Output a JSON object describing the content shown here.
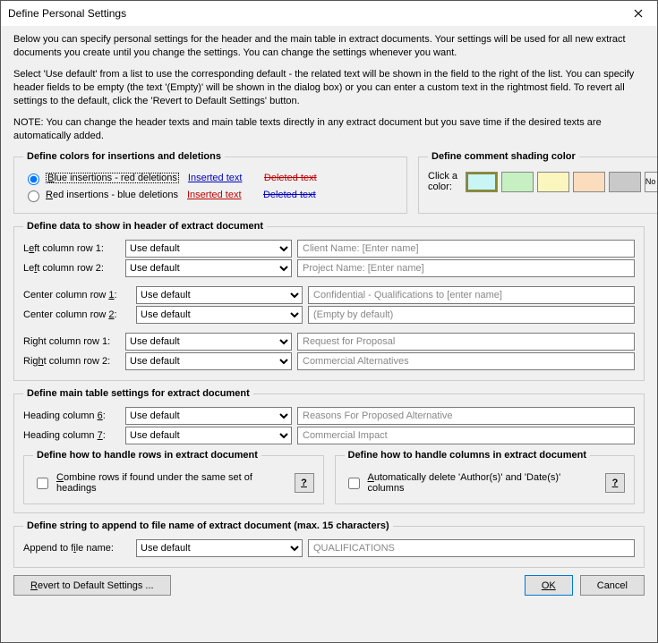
{
  "window": {
    "title": "Define Personal Settings"
  },
  "intro": {
    "p1": "Below you can specify personal settings for the header and the main table in extract documents. Your settings will be used for all new extract documents you create until you change the settings. You can change the settings whenever you want.",
    "p2": "Select 'Use default' from a list to use the corresponding default - the related text will be shown in the field to the right of the list. You can specify header fields to be empty (the text '(Empty)' will be shown in the dialog box) or you can enter a custom text in the rightmost field. To revert all settings to the default, click the 'Revert to Default Settings' button.",
    "p3": "NOTE: You can change the header texts and main table texts directly in any extract document but you save time if the desired texts are automatically added."
  },
  "colors": {
    "legend": "Define colors for insertions and deletions",
    "opt1": {
      "label": "Blue insertions - red deletions",
      "ins": "Inserted text",
      "del": "Deleted text"
    },
    "opt2": {
      "label": "Red insertions - blue deletions",
      "ins": "Inserted text",
      "del": "Deleted text"
    }
  },
  "shade": {
    "legend": "Define comment shading color",
    "label": "Click a color:",
    "colors": [
      "#C9F5F7",
      "#C7F0C2",
      "#FBF6BE",
      "#FBDDBE",
      "#C9C9C9"
    ],
    "nocolor": "No color"
  },
  "header": {
    "legend": "Define data to show in header of extract document",
    "default_option": "Use default",
    "left1": {
      "label": "Left column row 1:",
      "text": "Client Name: [Enter name]"
    },
    "left2": {
      "label": "Left column row 2:",
      "text": "Project Name: [Enter name]"
    },
    "center1": {
      "label": "Center column row 1:",
      "text": "Confidential - Qualifications to [enter name]"
    },
    "center2": {
      "label": "Center column row 2:",
      "text": "(Empty by default)"
    },
    "right1": {
      "label": "Right column row 1:",
      "text": "Request for Proposal"
    },
    "right2": {
      "label": "Right column row 2:",
      "text": "Commercial Alternatives"
    }
  },
  "table": {
    "legend": "Define main table settings for extract document",
    "h6": {
      "label": "Heading column 6:",
      "text": "Reasons For Proposed Alternative"
    },
    "h7": {
      "label": "Heading column 7:",
      "text": "Commercial Impact"
    },
    "rows": {
      "legend": "Define how to handle rows in extract document",
      "chk": "Combine rows if found under the same set of headings"
    },
    "cols": {
      "legend": "Define how to handle columns in extract document",
      "chk": "Automatically delete 'Author(s)' and 'Date(s)' columns"
    }
  },
  "append": {
    "legend": "Define string to append to file name of extract document  (max. 15 characters)",
    "label": "Append to file name:",
    "text": "QUALIFICATIONS"
  },
  "buttons": {
    "revert": "Revert to Default Settings ...",
    "ok": "OK",
    "cancel": "Cancel",
    "help": "?"
  }
}
